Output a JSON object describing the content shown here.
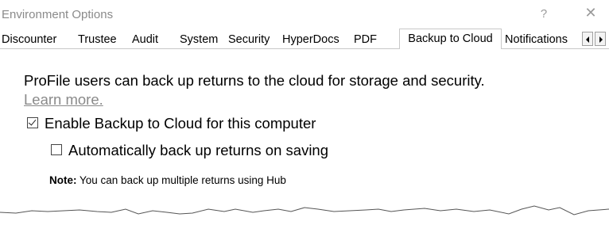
{
  "window": {
    "title": "Environment Options",
    "help_label": "?",
    "close_label": "✕"
  },
  "tabs": [
    {
      "label": "Discounter"
    },
    {
      "label": "Trustee"
    },
    {
      "label": "Audit"
    },
    {
      "label": "System"
    },
    {
      "label": "Security"
    },
    {
      "label": "HyperDocs"
    },
    {
      "label": "PDF"
    },
    {
      "label": "Backup to Cloud",
      "active": true
    },
    {
      "label": "Notifications"
    }
  ],
  "panel": {
    "description": "ProFile users can back up returns to the cloud for storage and security.",
    "learn_more": "Learn more.",
    "enable_backup": {
      "label": "Enable Backup to Cloud for this computer",
      "checked": true
    },
    "auto_backup": {
      "label": "Automatically back up returns on saving",
      "checked": false
    },
    "note_label": "Note:",
    "note_text": " You can back up multiple returns using Hub"
  },
  "icons": [
    "help-icon",
    "close-icon",
    "scroll-left-icon",
    "scroll-right-icon",
    "check-icon"
  ],
  "colors": {
    "muted_text": "#8a8a8a",
    "border": "#c8c8c8"
  }
}
